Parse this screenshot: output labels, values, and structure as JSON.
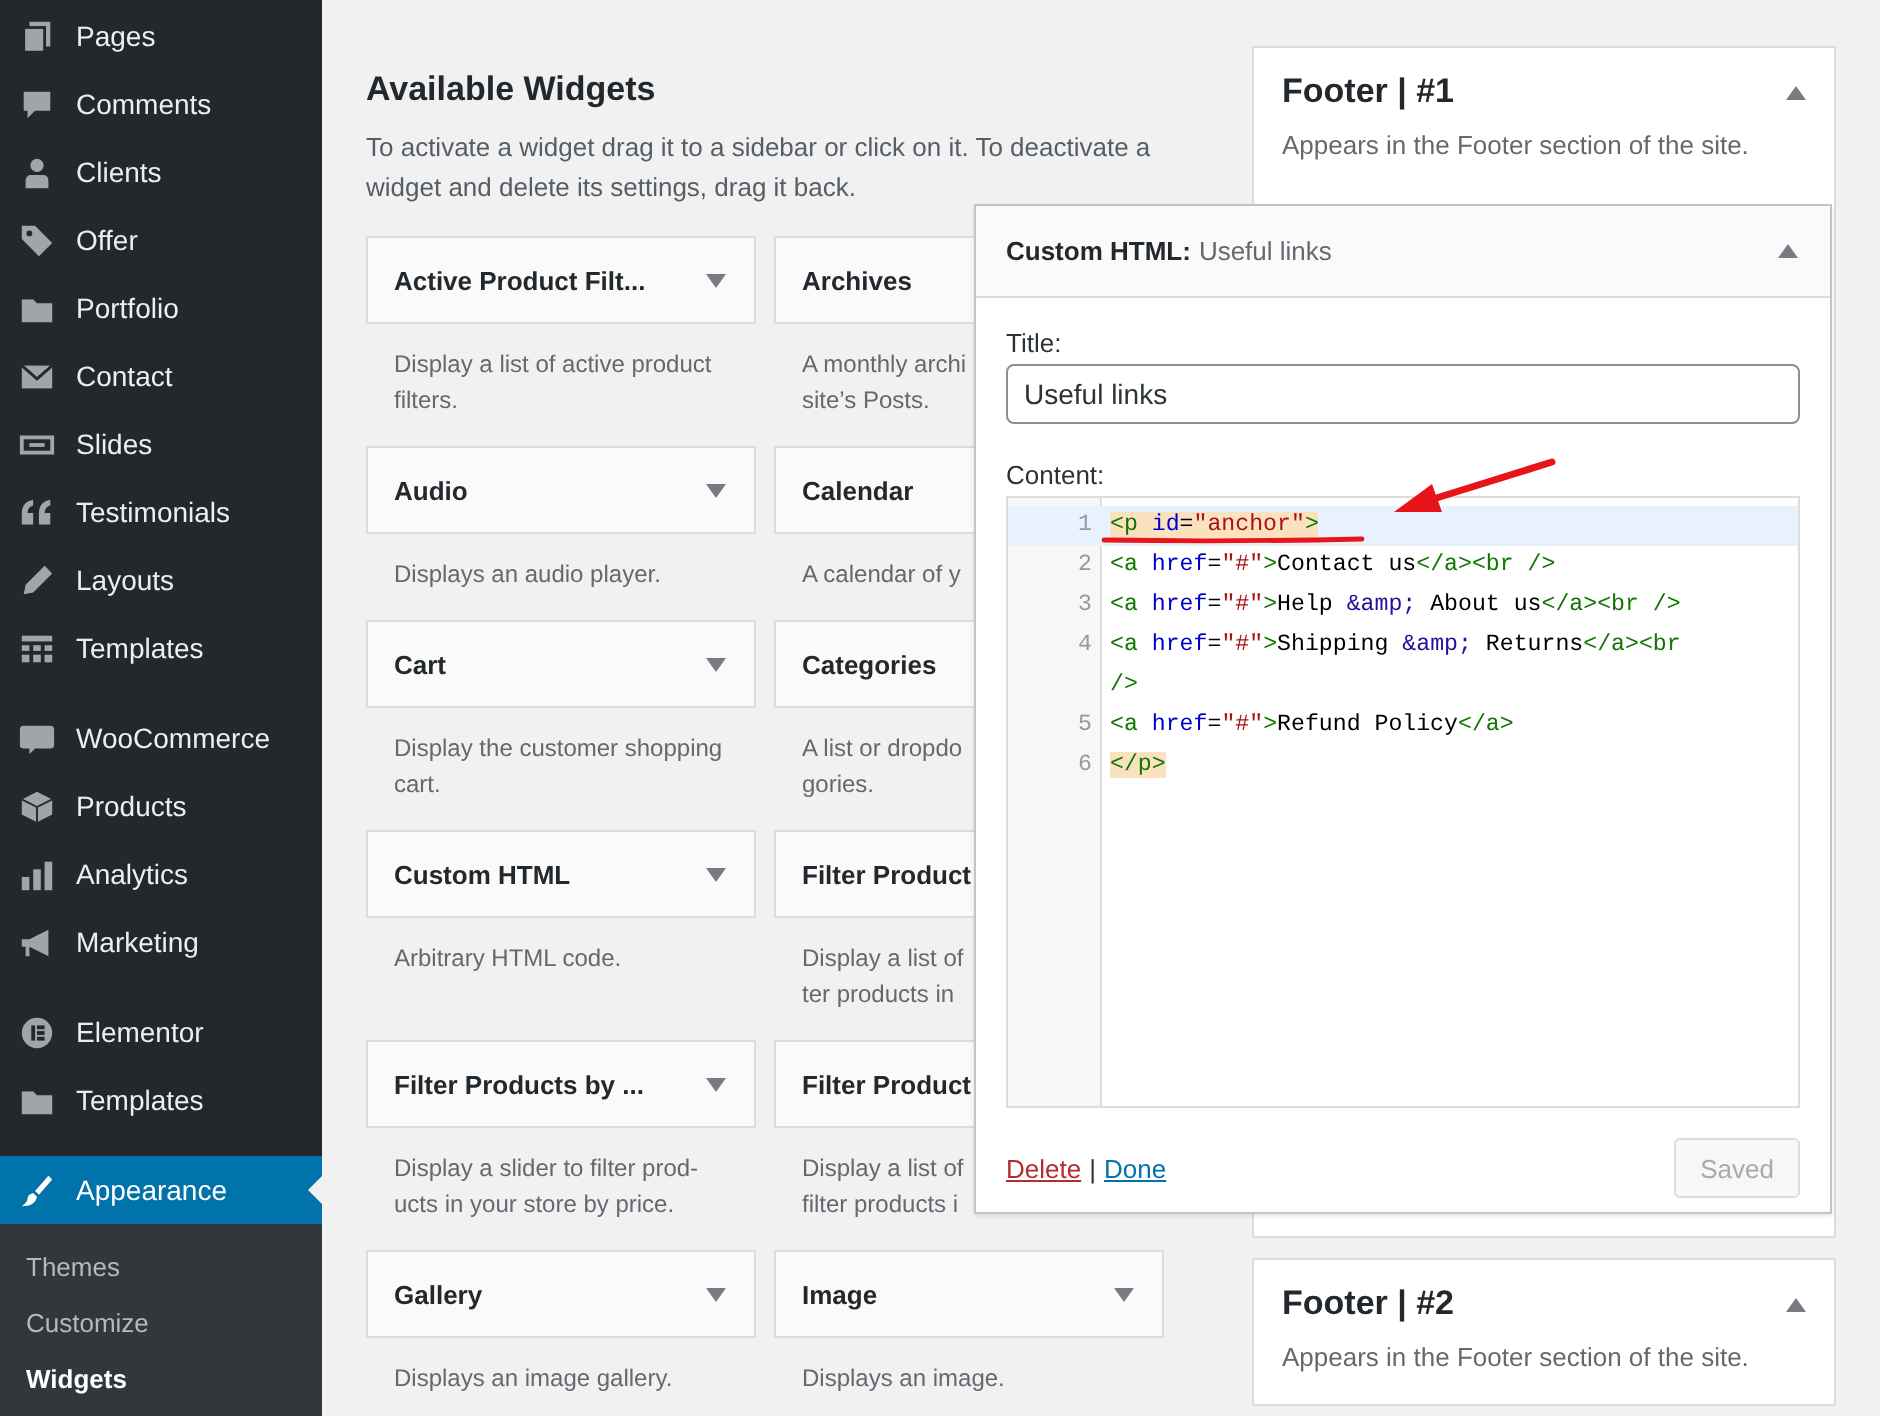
{
  "sidebar": {
    "groups": [
      [
        {
          "label": "Pages",
          "selected": false
        },
        {
          "label": "Comments",
          "selected": false
        },
        {
          "label": "Clients",
          "selected": false
        },
        {
          "label": "Offer",
          "selected": false
        },
        {
          "label": "Portfolio",
          "selected": false
        },
        {
          "label": "Contact",
          "selected": false
        },
        {
          "label": "Slides",
          "selected": false
        },
        {
          "label": "Testimonials",
          "selected": false
        },
        {
          "label": "Layouts",
          "selected": false
        },
        {
          "label": "Templates",
          "selected": false
        }
      ],
      [
        {
          "label": "WooCommerce",
          "selected": false
        },
        {
          "label": "Products",
          "selected": false
        },
        {
          "label": "Analytics",
          "selected": false
        },
        {
          "label": "Marketing",
          "selected": false
        }
      ],
      [
        {
          "label": "Elementor",
          "selected": false
        },
        {
          "label": "Templates",
          "selected": false
        }
      ],
      [
        {
          "label": "Appearance",
          "selected": true
        }
      ]
    ],
    "submenu": [
      {
        "label": "Themes",
        "selected": false
      },
      {
        "label": "Customize",
        "selected": false
      },
      {
        "label": "Widgets",
        "selected": true
      }
    ]
  },
  "available_widgets": {
    "title": "Available Widgets",
    "description": "To activate a widget drag it to a sidebar or click on it. To deactivate a widget and delete its settings, drag it back.",
    "widgets": [
      {
        "title": "Active Product Filt...",
        "caret": true,
        "description_lines": [
          "Display a list of active product",
          "filters."
        ]
      },
      {
        "title": "Archives",
        "description_lines": [
          "A monthly archi",
          "site’s Posts."
        ]
      },
      {
        "title": "Audio",
        "caret": true,
        "description_lines": [
          "Displays an audio player."
        ]
      },
      {
        "title": "Calendar",
        "description_lines": [
          "A calendar of y"
        ]
      },
      {
        "title": "Cart",
        "caret": true,
        "description_lines": [
          "Display the customer shopping",
          "cart."
        ]
      },
      {
        "title": "Categories",
        "description_lines": [
          "A list or dropdo",
          "gories."
        ]
      },
      {
        "title": "Custom HTML",
        "caret": true,
        "description_lines": [
          "Arbitrary HTML code."
        ]
      },
      {
        "title": "Filter Product",
        "description_lines": [
          "Display a list of",
          "ter products in"
        ]
      },
      {
        "title": "Filter Products by ...",
        "caret": true,
        "description_lines": [
          "Display a slider to filter prod-",
          "ucts in your store by price."
        ]
      },
      {
        "title": "Filter Product",
        "description_lines": [
          "Display a list of",
          "filter products i"
        ]
      },
      {
        "title": "Gallery",
        "caret": true,
        "description_lines": [
          "Displays an image gallery."
        ]
      },
      {
        "title": "Image",
        "caret": true,
        "description_lines": [
          "Displays an image."
        ]
      }
    ]
  },
  "sidebars": [
    {
      "title": "Footer | #1",
      "description": "Appears in the Footer section of the site.",
      "expanded": true
    },
    {
      "title": "Footer | #2",
      "description": "Appears in the Footer section of the site.",
      "expanded": true
    }
  ],
  "widget_editor": {
    "widget_type": "Custom HTML:",
    "widget_title": "Useful links",
    "expanded": true,
    "title_label": "Title:",
    "title_value": "Useful links",
    "content_label": "Content:",
    "code_lines": [
      {
        "number": "1",
        "active": true,
        "matched": true,
        "tokens": [
          {
            "kind": "tag",
            "text": "<p"
          },
          {
            "kind": "attr",
            "text": " id"
          },
          {
            "kind": "text",
            "text": "="
          },
          {
            "kind": "string",
            "text": "\"anchor\""
          },
          {
            "kind": "tag",
            "text": ">"
          }
        ]
      },
      {
        "number": "2",
        "active": false,
        "matched": false,
        "tokens": [
          {
            "kind": "tag",
            "text": "<a"
          },
          {
            "kind": "attr",
            "text": " href"
          },
          {
            "kind": "text",
            "text": "="
          },
          {
            "kind": "string",
            "text": "\"#\""
          },
          {
            "kind": "tag",
            "text": ">"
          },
          {
            "kind": "text",
            "text": "Contact us"
          },
          {
            "kind": "tag",
            "text": "</a>"
          },
          {
            "kind": "tag",
            "text": "<br"
          },
          {
            "kind": "tag",
            "text": " />"
          }
        ]
      },
      {
        "number": "3",
        "active": false,
        "matched": false,
        "tokens": [
          {
            "kind": "tag",
            "text": "<a"
          },
          {
            "kind": "attr",
            "text": " href"
          },
          {
            "kind": "text",
            "text": "="
          },
          {
            "kind": "string",
            "text": "\"#\""
          },
          {
            "kind": "tag",
            "text": ">"
          },
          {
            "kind": "text",
            "text": "Help "
          },
          {
            "kind": "entity",
            "text": "&amp;"
          },
          {
            "kind": "text",
            "text": " About us"
          },
          {
            "kind": "tag",
            "text": "</a>"
          },
          {
            "kind": "tag",
            "text": "<br"
          },
          {
            "kind": "tag",
            "text": " />"
          }
        ]
      },
      {
        "number": "4",
        "active": false,
        "matched": false,
        "tokens": [
          {
            "kind": "tag",
            "text": "<a"
          },
          {
            "kind": "attr",
            "text": " href"
          },
          {
            "kind": "text",
            "text": "="
          },
          {
            "kind": "string",
            "text": "\"#\""
          },
          {
            "kind": "tag",
            "text": ">"
          },
          {
            "kind": "text",
            "text": "Shipping "
          },
          {
            "kind": "entity",
            "text": "&amp;"
          },
          {
            "kind": "text",
            "text": " Returns"
          },
          {
            "kind": "tag",
            "text": "</a>"
          },
          {
            "kind": "tag",
            "text": "<br"
          },
          {
            "kind": "tag",
            "text": " />"
          }
        ]
      },
      {
        "number": "5",
        "active": false,
        "matched": false,
        "tokens": [
          {
            "kind": "tag",
            "text": "<a"
          },
          {
            "kind": "attr",
            "text": " href"
          },
          {
            "kind": "text",
            "text": "="
          },
          {
            "kind": "string",
            "text": "\"#\""
          },
          {
            "kind": "tag",
            "text": ">"
          },
          {
            "kind": "text",
            "text": "Refund Policy"
          },
          {
            "kind": "tag",
            "text": "</a>"
          }
        ]
      },
      {
        "number": "6",
        "active": false,
        "matched": true,
        "tokens": [
          {
            "kind": "tag",
            "text": "</p>"
          }
        ]
      }
    ],
    "delete_link": "Delete",
    "separator": "|",
    "done_link": "Done",
    "save_button": {
      "label": "Saved",
      "disabled": true
    }
  }
}
